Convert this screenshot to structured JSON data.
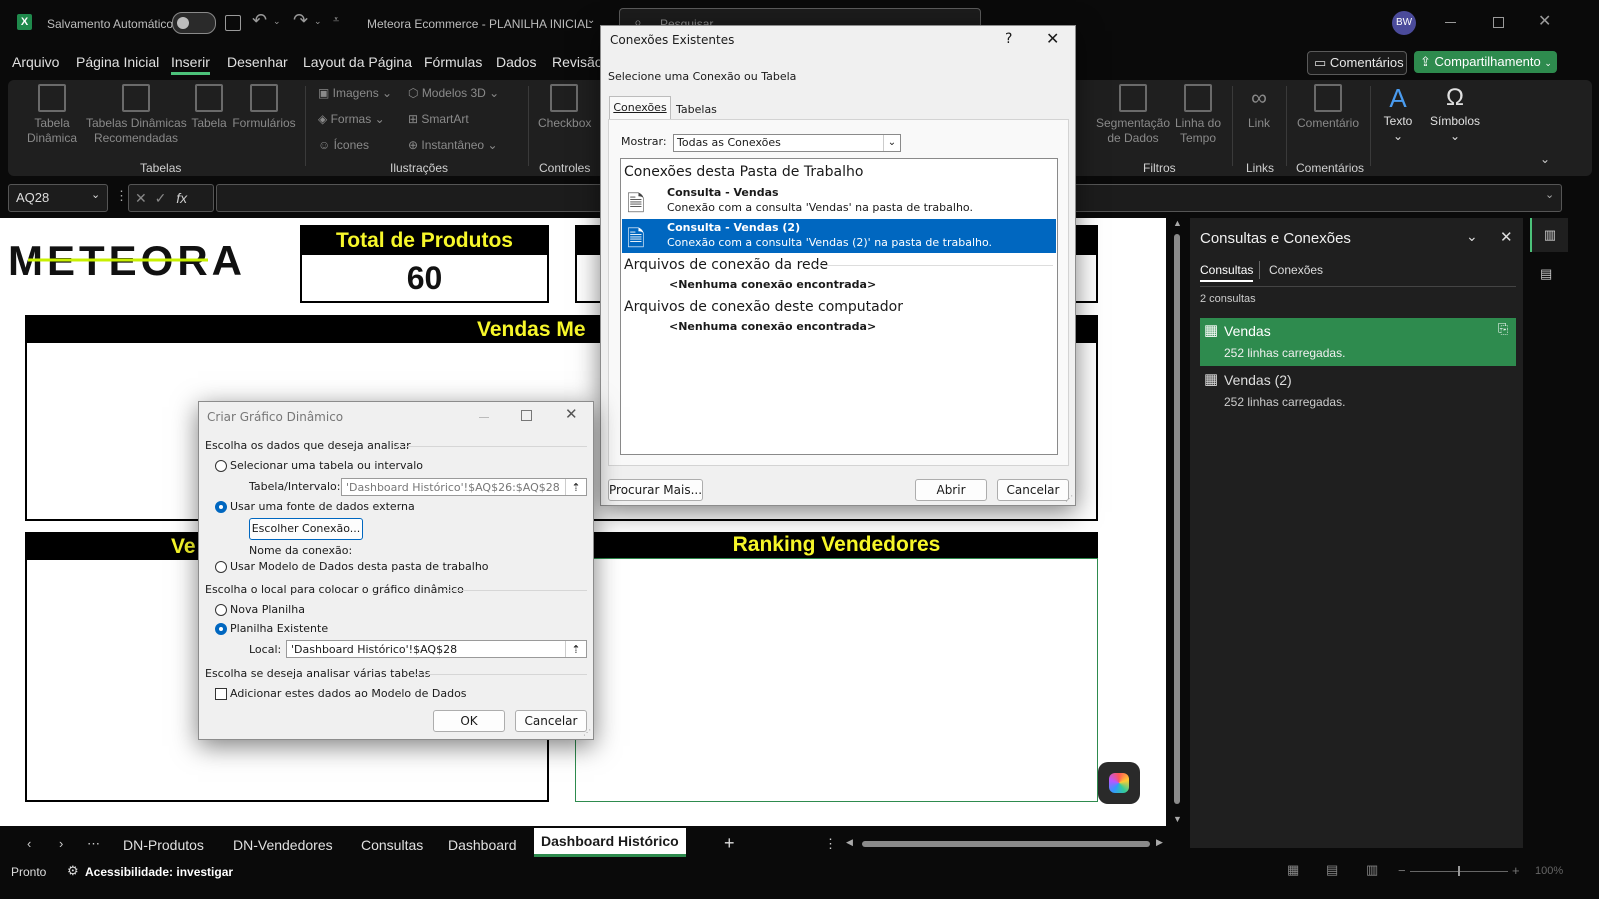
{
  "titlebar": {
    "autosave_label": "Salvamento Automático",
    "doc_title": "Meteora Ecommerce - PLANILHA INICIAL",
    "search_placeholder": "Pesquisar",
    "user_initials": "BW"
  },
  "menu": {
    "items": [
      "Arquivo",
      "Página Inicial",
      "Inserir",
      "Desenhar",
      "Layout da Página",
      "Fórmulas",
      "Dados",
      "Revisão"
    ],
    "active": "Inserir",
    "comments_btn": "Comentários",
    "share_btn": "Compartilhamento"
  },
  "ribbon": {
    "tabela_dinamica": "Tabela\nDinâmica",
    "tabelas_dinamicas_rec": "Tabelas Dinâmicas\nRecomendadas",
    "tabela": "Tabela",
    "formularios": "Formulários",
    "grp_tabelas": "Tabelas",
    "imagens": "Imagens",
    "formas": "Formas",
    "icones": "Ícones",
    "modelos3d": "Modelos 3D",
    "smartart": "SmartArt",
    "instantaneo": "Instantâneo",
    "grp_ilustracoes": "Ilustrações",
    "checkbox": "Checkbox",
    "grp_controles": "Controles",
    "segmentacao": "Segmentação\nde Dados",
    "linha_tempo": "Linha do\nTempo",
    "grp_filtros": "Filtros",
    "link": "Link",
    "grp_links": "Links",
    "comentario": "Comentário",
    "grp_comentarios": "Comentários",
    "texto": "Texto",
    "simbolos": "Símbolos"
  },
  "formula_bar": {
    "name_box": "AQ28",
    "fx": "fx"
  },
  "sheet": {
    "logo_text": "METEORA",
    "card1_title": "Total de Produtos",
    "card1_value": "60",
    "vendas_title": "Vendas Me",
    "ve_title": "Ve",
    "ranking_title": "Ranking Vendedores"
  },
  "panel": {
    "title": "Consultas e Conexões",
    "tab_consultas": "Consultas",
    "tab_conexoes": "Conexões",
    "count": "2 consultas",
    "queries": [
      {
        "name": "Vendas",
        "detail": "252 linhas carregadas."
      },
      {
        "name": "Vendas (2)",
        "detail": "252 linhas carregadas."
      }
    ]
  },
  "sheet_tabs": [
    "DN-Produtos",
    "DN-Vendedores",
    "Consultas",
    "Dashboard",
    "Dashboard Histórico"
  ],
  "active_tab": "Dashboard Histórico",
  "status": {
    "ready": "Pronto",
    "accessibility": "Acessibilidade: investigar",
    "zoom": "100%"
  },
  "conexoes_dialog": {
    "title": "Conexões Existentes",
    "help": "?",
    "subtitle": "Selecione uma Conexão ou Tabela",
    "tab_conexoes": "Conexões",
    "tab_tabelas": "Tabelas",
    "mostrar_label": "Mostrar:",
    "mostrar_value": "Todas as Conexões",
    "section_workbook": "Conexões desta Pasta de Trabalho",
    "items": [
      {
        "name": "Consulta - Vendas",
        "desc": "Conexão com a consulta 'Vendas' na pasta de trabalho."
      },
      {
        "name": "Consulta - Vendas (2)",
        "desc": "Conexão com a consulta 'Vendas (2)' na pasta de trabalho."
      }
    ],
    "section_network": "Arquivos de conexão da rede",
    "none_network": "<Nenhuma conexão encontrada>",
    "section_computer": "Arquivos de conexão deste computador",
    "none_computer": "<Nenhuma conexão encontrada>",
    "btn_browse": "Procurar Mais...",
    "btn_open": "Abrir",
    "btn_cancel": "Cancelar"
  },
  "pivot_dialog": {
    "title": "Criar Gráfico Dinâmico",
    "sec1": "Escolha os dados que deseja analisar",
    "opt_table": "Selecionar uma tabela ou intervalo",
    "range_label": "Tabela/Intervalo:",
    "range_value": "'Dashboard Histórico'!$AQ$26:$AQ$28",
    "opt_external": "Usar uma fonte de dados externa",
    "btn_choose": "Escolher Conexão...",
    "conn_name_label": "Nome da conexão:",
    "opt_model": "Usar Modelo de Dados desta pasta de trabalho",
    "sec2": "Escolha o local para colocar o gráfico dinâmico",
    "opt_new": "Nova Planilha",
    "opt_existing": "Planilha Existente",
    "local_label": "Local:",
    "local_value": "'Dashboard Histórico'!$AQ$28",
    "sec3": "Escolha se deseja analisar várias tabelas",
    "chk_model": "Adicionar estes dados ao Modelo de Dados",
    "btn_ok": "OK",
    "btn_cancel": "Cancelar"
  }
}
